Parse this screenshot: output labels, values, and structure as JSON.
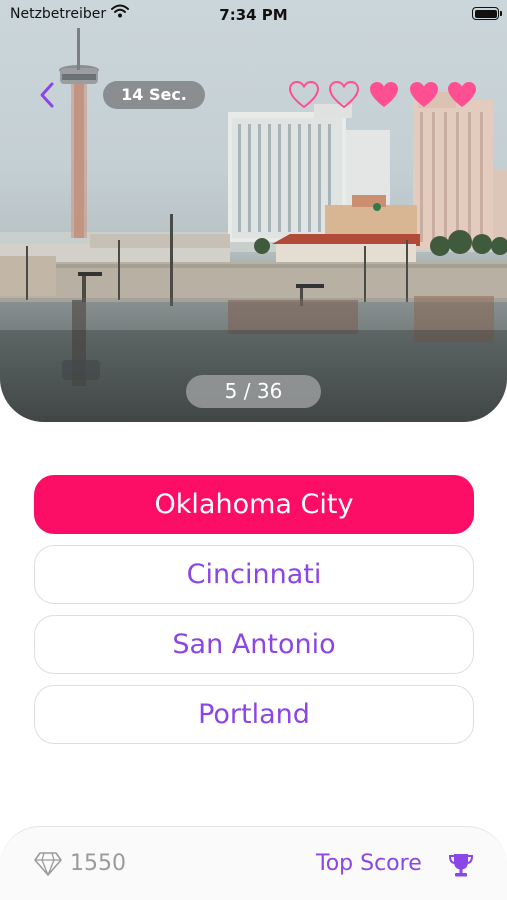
{
  "status_bar": {
    "carrier": "Netzbetreiber",
    "time": "7:34 PM",
    "icons": [
      "wifi-icon",
      "battery-icon"
    ]
  },
  "quiz": {
    "timer": "14 Sec.",
    "lives": {
      "total": 5,
      "lost": 2,
      "icon": "heart-icon"
    },
    "progress": "5 / 36",
    "back_icon": "chevron-left-icon",
    "image": "city skyline photo with tower and hotel buildings reflected in water",
    "answers": [
      {
        "label": "Oklahoma City",
        "selected": true
      },
      {
        "label": "Cincinnati",
        "selected": false
      },
      {
        "label": "San Antonio",
        "selected": false
      },
      {
        "label": "Portland",
        "selected": false
      }
    ]
  },
  "footer": {
    "gems": "1550",
    "gem_icon": "diamond-icon",
    "top_score_label": "Top Score",
    "trophy_icon": "trophy-icon"
  },
  "colors": {
    "accent": "#8a46e6",
    "selected": "#fc0d66",
    "heart": "#ff4f93"
  }
}
